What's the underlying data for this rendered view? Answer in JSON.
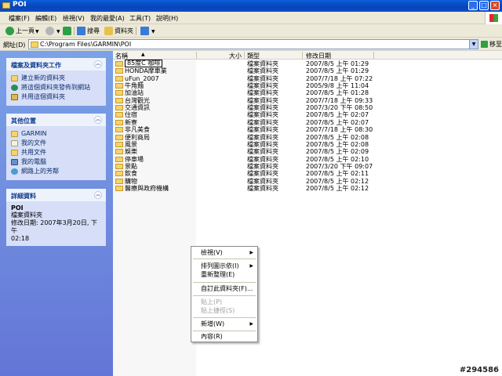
{
  "window": {
    "title": "POI"
  },
  "menu": [
    "檔案(F)",
    "編輯(E)",
    "檢視(V)",
    "我的最愛(A)",
    "工具(T)",
    "說明(H)"
  ],
  "toolbar": {
    "back": "上一頁",
    "search": "搜尋",
    "folders": "資料夾"
  },
  "address": {
    "label": "網址(D)",
    "value": "C:\\Program Files\\GARMIN\\POI",
    "go": "移至"
  },
  "tasks_panel": {
    "title": "檔案及資料夾工作",
    "items": [
      "建立新的資料夾",
      "將這個資料夾發佈到網站",
      "共用這個資料夾"
    ]
  },
  "places_panel": {
    "title": "其他位置",
    "items": [
      "GARMIN",
      "我的文件",
      "共用文件",
      "我的電腦",
      "網路上的芳鄰"
    ]
  },
  "details_panel": {
    "title": "詳細資料",
    "name": "POI",
    "type": "檔案資料夾",
    "modified_1": "修改日期: 2007年3月20日, 下午",
    "modified_2": "02:18"
  },
  "columns": {
    "name": "名稱",
    "size": "大小",
    "type": "類型",
    "date": "修改日期"
  },
  "files": [
    {
      "name": "85度C 咖啡",
      "type": "檔案資料夾",
      "date": "2007/8/5 上午 01:29"
    },
    {
      "name": "HONDA摩車業",
      "type": "檔案資料夾",
      "date": "2007/8/5 上午 01:29"
    },
    {
      "name": "uFun_2007",
      "type": "檔案資料夾",
      "date": "2007/7/18 上午 07:22"
    },
    {
      "name": "牛角麵",
      "type": "檔案資料夾",
      "date": "2005/9/8 上午 11:04"
    },
    {
      "name": "加油站",
      "type": "檔案資料夾",
      "date": "2007/8/5 上午 01:28"
    },
    {
      "name": "台灣觀光",
      "type": "檔案資料夾",
      "date": "2007/7/18 上午 09:33"
    },
    {
      "name": "交通資訊",
      "type": "檔案資料夾",
      "date": "2007/3/20 下午 08:50"
    },
    {
      "name": "住宿",
      "type": "檔案資料夾",
      "date": "2007/8/5 上午 02:07"
    },
    {
      "name": "新寮",
      "type": "檔案資料夾",
      "date": "2007/8/5 上午 02:07"
    },
    {
      "name": "非凡美食",
      "type": "檔案資料夾",
      "date": "2007/7/18 上午 08:30"
    },
    {
      "name": "便利商局",
      "type": "檔案資料夾",
      "date": "2007/8/5 上午 02:08"
    },
    {
      "name": "風景",
      "type": "檔案資料夾",
      "date": "2007/8/5 上午 02:08"
    },
    {
      "name": "娛樂",
      "type": "檔案資料夾",
      "date": "2007/8/5 上午 02:09"
    },
    {
      "name": "停車場",
      "type": "檔案資料夾",
      "date": "2007/8/5 上午 02:10"
    },
    {
      "name": "景點",
      "type": "檔案資料夾",
      "date": "2007/3/20 下午 09:07"
    },
    {
      "name": "飲食",
      "type": "檔案資料夾",
      "date": "2007/8/5 上午 02:11"
    },
    {
      "name": "購物",
      "type": "檔案資料夾",
      "date": "2007/8/5 上午 02:12"
    },
    {
      "name": "醫療與政府機構",
      "type": "檔案資料夾",
      "date": "2007/8/5 上午 02:12"
    }
  ],
  "context_menu": {
    "view": "檢視(V)",
    "arrange": "排列圖示依(I)",
    "refresh": "重新整理(E)",
    "customize": "自訂此資料夾(F)...",
    "paste": "貼上(P)",
    "paste_shortcut": "貼上捷徑(S)",
    "new": "新增(W)",
    "properties": "內容(R)"
  },
  "watermark": "#294586"
}
